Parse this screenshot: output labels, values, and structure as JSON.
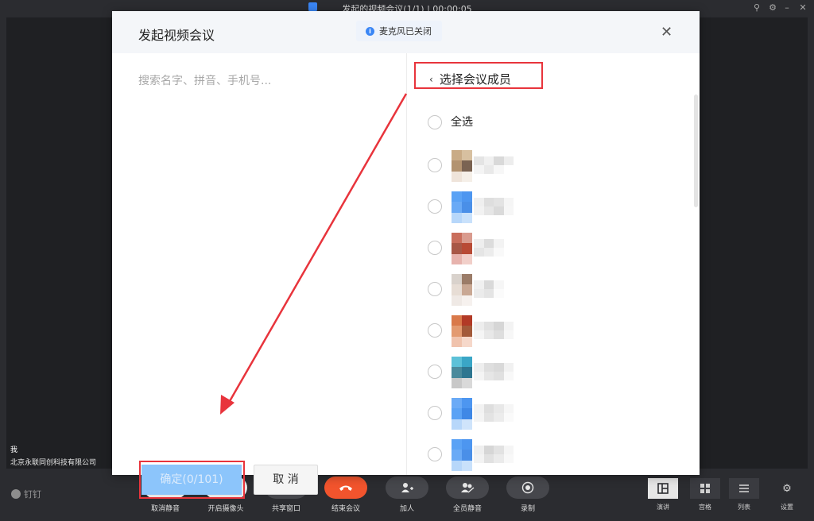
{
  "window": {
    "title": "发起的视频会议(1/1) | 00:00:05",
    "controls": [
      "pin-icon",
      "settings-icon",
      "minimize-icon",
      "close-icon"
    ]
  },
  "stage": {
    "self_name": "我",
    "self_org": "北京永联同创科技有限公司"
  },
  "toolbar": {
    "brand": "钉钉",
    "buttons": [
      {
        "label": "取消静音",
        "icon": "mic-off-icon"
      },
      {
        "label": "开启摄像头",
        "icon": "camera-off-icon"
      },
      {
        "label": "共享窗口",
        "icon": "share-screen-icon"
      },
      {
        "label": "结束会议",
        "icon": "hangup-icon"
      },
      {
        "label": "加人",
        "icon": "add-person-icon"
      },
      {
        "label": "全员静音",
        "icon": "mute-all-icon"
      },
      {
        "label": "录制",
        "icon": "record-icon"
      }
    ],
    "views": [
      {
        "label": "演讲",
        "icon": "speaker-view-icon"
      },
      {
        "label": "宫格",
        "icon": "grid-view-icon"
      },
      {
        "label": "列表",
        "icon": "list-view-icon"
      },
      {
        "label": "设置",
        "icon": "gear-icon"
      }
    ]
  },
  "dialog": {
    "title": "发起视频会议",
    "toast": "麦克风已关闭",
    "search_placeholder": "搜索名字、拼音、手机号...",
    "confirm_label": "确定(0/101)",
    "cancel_label": "取 消",
    "member_panel": {
      "back_label": "选择会议成员",
      "select_all_label": "全选",
      "members": [
        {
          "avatar": [
            "#c9ab86",
            "#d7c0a0",
            "#b39370",
            "#7a6352",
            "#efe4da",
            "#f5efe8"
          ],
          "name_blur": [
            "#e4e4e4",
            "#f0f0f0",
            "#d9d9d9",
            "#ededed",
            "#f4f4f4",
            "#e9e9e9",
            "#f7f7f7",
            "#ffffff"
          ]
        },
        {
          "avatar": [
            "#5aa2f5",
            "#4d96f0",
            "#6aaaf6",
            "#4a8fe8",
            "#b7d7fa",
            "#c9e1fb"
          ],
          "name_blur": [
            "#efefef",
            "#dedede",
            "#e3e3e3",
            "#f5f5f5",
            "#f2f2f2",
            "#e6e6e6",
            "#dadada",
            "#f6f6f6"
          ]
        },
        {
          "avatar": [
            "#c96e5c",
            "#d99b8e",
            "#a85746",
            "#b84a35",
            "#e7b3ad",
            "#f1cfc9"
          ],
          "name_blur": [
            "#eeeeee",
            "#dcdcdc",
            "#f3f3f3",
            "#ffffff",
            "#e5e5e5",
            "#ececec",
            "#f9f9f9",
            "#ffffff"
          ]
        },
        {
          "avatar": [
            "#d9d2cc",
            "#9b7c68",
            "#e7ddd5",
            "#c9a894",
            "#efe9e5",
            "#f6f1ee"
          ],
          "name_blur": [
            "#f0f0f0",
            "#d9d9d9",
            "#f6f6f6",
            "#ffffff",
            "#ebebeb",
            "#e4e4e4",
            "#fbfbfb",
            "#ffffff"
          ]
        },
        {
          "avatar": [
            "#d9794a",
            "#b23a26",
            "#e39a70",
            "#a35a3a",
            "#f0c3ad",
            "#f6d8ca"
          ],
          "name_blur": [
            "#ededed",
            "#e1e1e1",
            "#d6d6d6",
            "#f3f3f3",
            "#f5f5f5",
            "#e8e8e8",
            "#dedede",
            "#f7f7f7"
          ]
        },
        {
          "avatar": [
            "#5cc1d8",
            "#3aa6c6",
            "#4a8a9c",
            "#2e7690",
            "#c8c8c8",
            "#d9d9d9"
          ],
          "name_blur": [
            "#eeeeee",
            "#dedede",
            "#d9d9d9",
            "#f1f1f1",
            "#f4f4f4",
            "#e6e6e6",
            "#e0e0e0",
            "#f8f8f8"
          ]
        },
        {
          "avatar": [
            "#6aaaf6",
            "#4d96f0",
            "#5aa2f5",
            "#3f88e6",
            "#b7d7fa",
            "#cfe4fb"
          ],
          "name_blur": [
            "#f2f2f2",
            "#dedede",
            "#e8e8e8",
            "#f6f6f6",
            "#f4f4f4",
            "#e3e3e3",
            "#ececec",
            "#fafafa"
          ]
        },
        {
          "avatar": [
            "#5aa2f5",
            "#4d96f0",
            "#6aaaf6",
            "#4a8fe8",
            "#b7d7fa",
            "#c9e1fb"
          ],
          "name_blur": [
            "#efefef",
            "#d6d6d6",
            "#e2e2e2",
            "#f5f5f5",
            "#f3f3f3",
            "#e1e1e1",
            "#ebebeb",
            "#f8f8f8"
          ]
        }
      ]
    }
  },
  "colors": {
    "accent": "#3a86f5",
    "danger": "#f2542d",
    "annotation": "#e8343c",
    "confirm_disabled": "#8cc5fb"
  }
}
